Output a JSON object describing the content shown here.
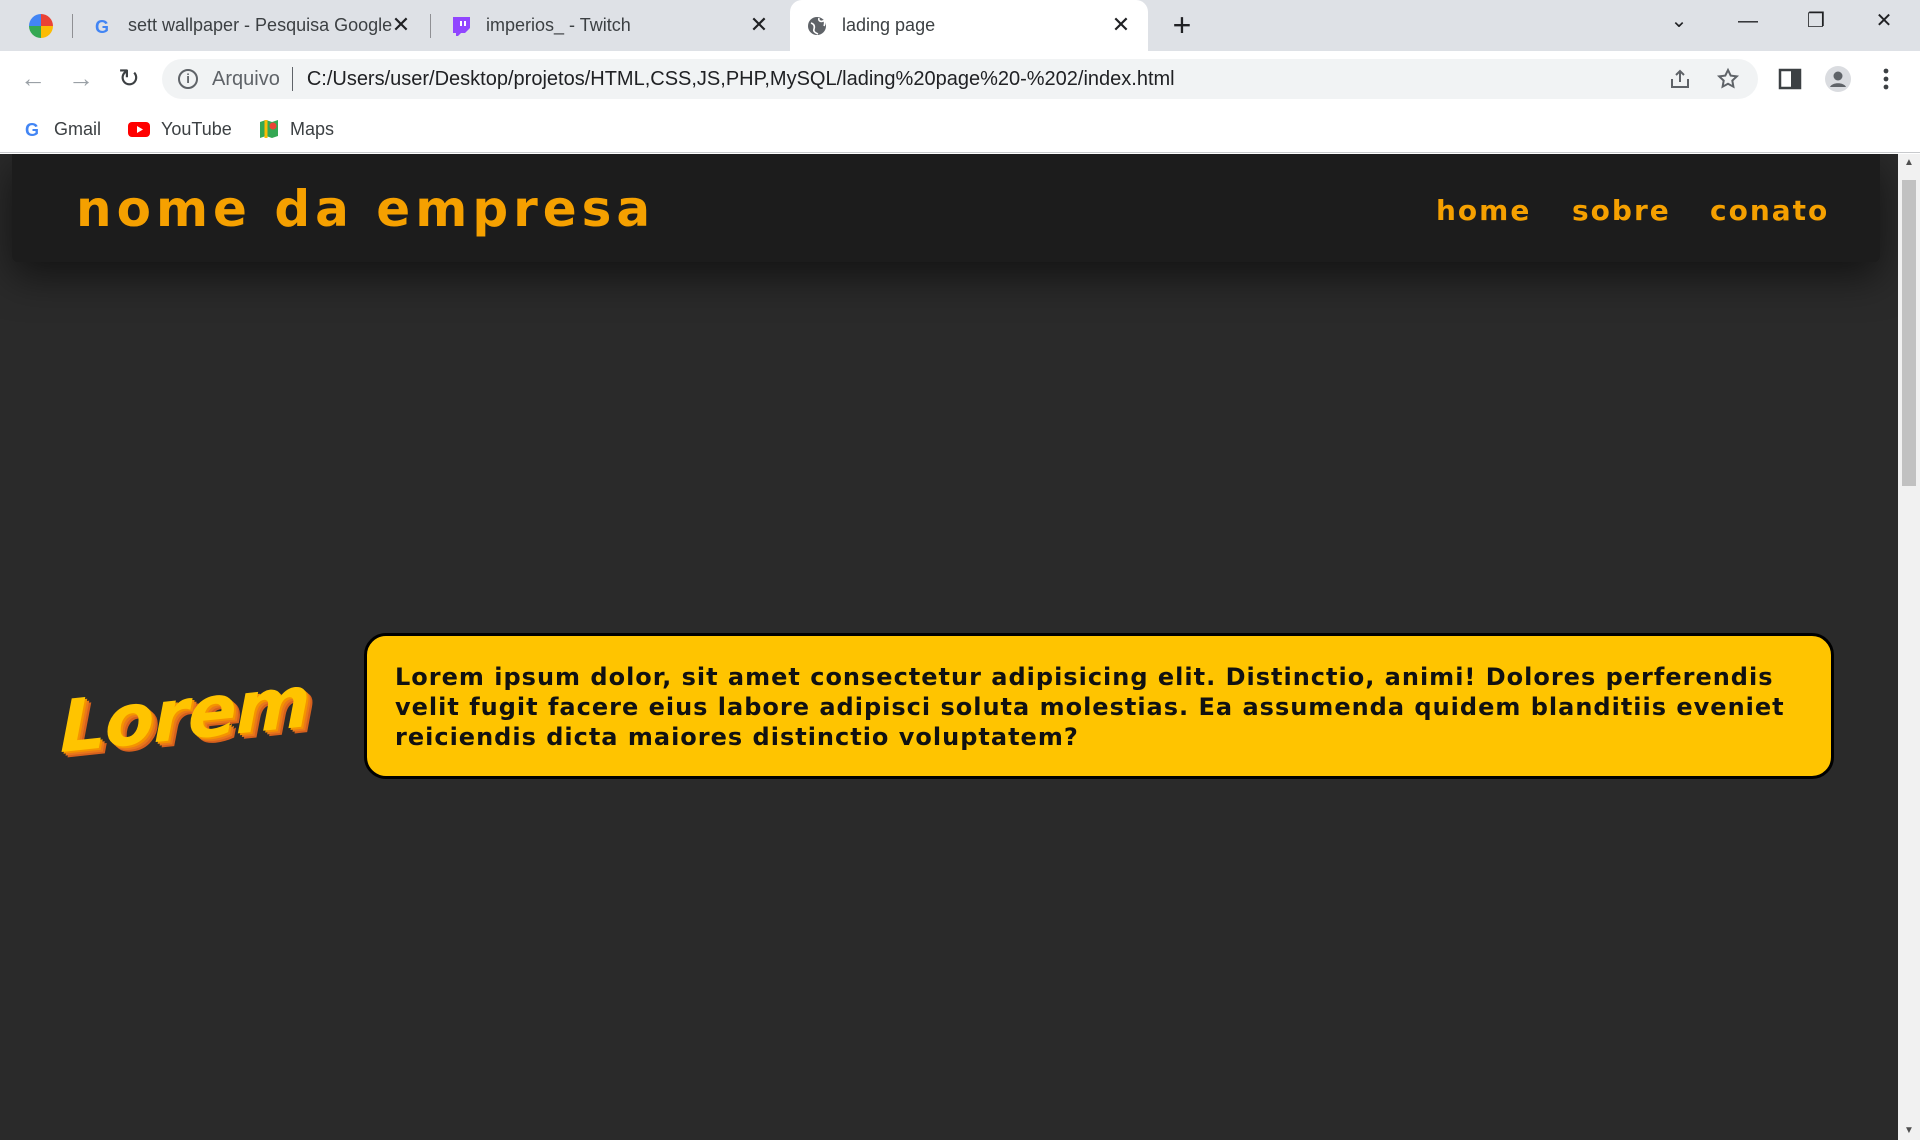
{
  "browser": {
    "tabs": [
      {
        "title": "sett wallpaper - Pesquisa Google",
        "icon": "google-icon",
        "active": false
      },
      {
        "title": "imperios_ - Twitch",
        "icon": "twitch-icon",
        "active": false
      },
      {
        "title": "lading page",
        "icon": "globe-icon",
        "active": true
      }
    ],
    "close_glyph": "✕",
    "new_tab_glyph": "+",
    "window_controls": {
      "tab_search": "⌄",
      "minimize": "—",
      "restore": "❐",
      "close": "✕"
    },
    "nav": {
      "back": "←",
      "forward": "→",
      "reload": "↻"
    },
    "omnibox": {
      "scheme_label": "Arquivo",
      "url": "C:/Users/user/Desktop/projetos/HTML,CSS,JS,PHP,MySQL/lading%20page%20-%202/index.html"
    },
    "bookmarks": [
      {
        "label": "Gmail",
        "icon": "google-icon"
      },
      {
        "label": "YouTube",
        "icon": "youtube-icon"
      },
      {
        "label": "Maps",
        "icon": "maps-icon"
      }
    ]
  },
  "page": {
    "brand": "nome da empresa",
    "nav": [
      "home",
      "sobre",
      "conato"
    ],
    "logo_text": "Lorem",
    "body_text": "Lorem ipsum dolor, sit amet consectetur adipisicing elit. Distinctio, animi! Dolores perferendis velit fugit facere eius labore adipisci soluta molestias. Ea assumenda quidem blanditiis eveniet reiciendis dicta maiores distinctio voluptatem?",
    "colors": {
      "background": "#2a2a2a",
      "header": "#1c1c1c",
      "accent": "#f5a000",
      "card": "#ffc400"
    }
  }
}
